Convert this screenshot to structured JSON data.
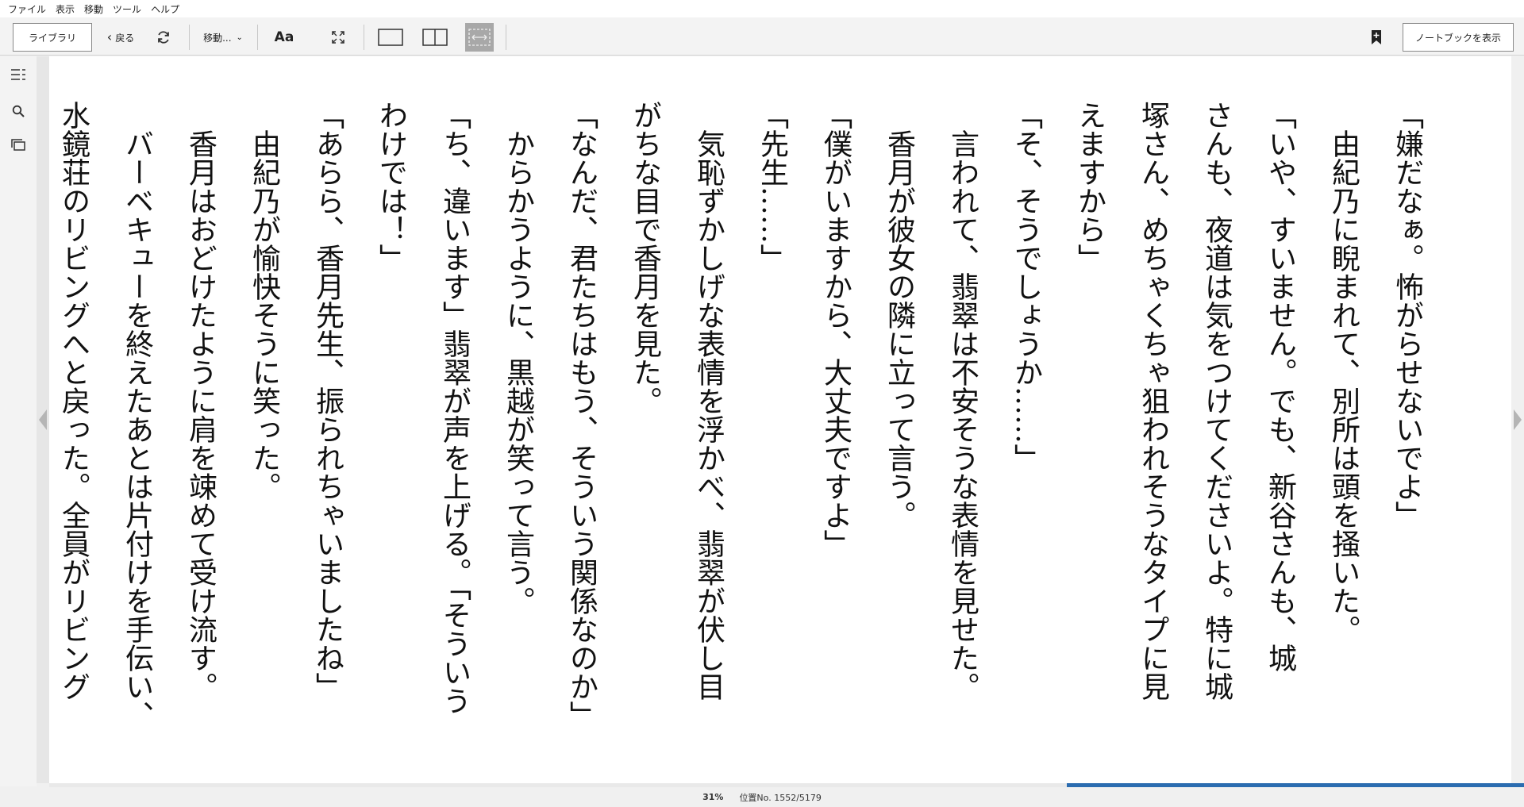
{
  "menubar": {
    "items": [
      "ファイル",
      "表示",
      "移動",
      "ツール",
      "ヘルプ"
    ]
  },
  "toolbar": {
    "library_label": "ライブラリ",
    "back_label": "戻る",
    "goto_label": "移動...",
    "font_label": "Aa",
    "notebook_label": "ノートブックを表示"
  },
  "reader": {
    "paragraphs": [
      "「嫌だなぁ。怖がらせないでよ」",
      "　由紀乃に睨まれて、別所は頭を掻いた。",
      "「いや、すいません。でも、新谷さんも、城",
      "さんも、夜道は気をつけてくださいよ。特に城",
      "塚さん、めちゃくちゃ狙われそうなタイプに見",
      "えますから」",
      "「そ、そうでしょうか……」",
      "　言われて、翡翠は不安そうな表情を見せた。",
      "　香月が彼女の隣に立って言う。",
      "「僕がいますから、大丈夫ですよ」",
      "「先生……」",
      "　気恥ずかしげな表情を浮かべ、翡翠が伏し目",
      "がちな目で香月を見た。",
      "「なんだ、君たちはもう、そういう関係なのか」",
      "　からかうように、黒越が笑って言う。",
      "「ち、違います」翡翠が声を上げる。「そういう",
      "わけでは！」",
      "「あらら、香月先生、振られちゃいましたね」",
      "　由紀乃が愉快そうに笑った。",
      "　香月はおどけたように肩を竦めて受け流す。",
      "　バーベキューを終えたあとは片付けを手伝い、",
      "水鏡荘のリビングへと戻った。全員がリビング"
    ]
  },
  "status": {
    "percent": "31%",
    "position": "位置No. 1552/5179",
    "progress_fraction": 0.31
  },
  "colors": {
    "accent": "#2b6cb0",
    "active_toggle": "#a8a8a8"
  }
}
